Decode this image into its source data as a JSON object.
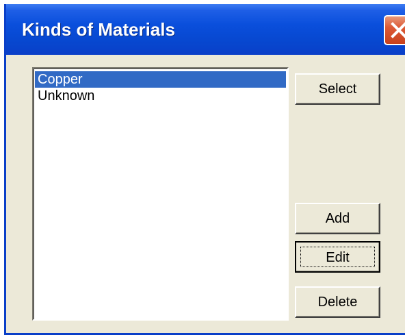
{
  "window": {
    "title": "Kinds of Materials"
  },
  "materials": {
    "items": [
      {
        "label": "Copper",
        "selected": true
      },
      {
        "label": "Unknown",
        "selected": false
      }
    ]
  },
  "buttons": {
    "select": "Select",
    "add": "Add",
    "edit": "Edit",
    "delete": "Delete"
  },
  "icons": {
    "close": "close-icon"
  },
  "colors": {
    "titlebar": "#0a4fdc",
    "selection": "#316ac5",
    "dialog_bg": "#ece9d8",
    "close_button": "#dc5a36"
  }
}
